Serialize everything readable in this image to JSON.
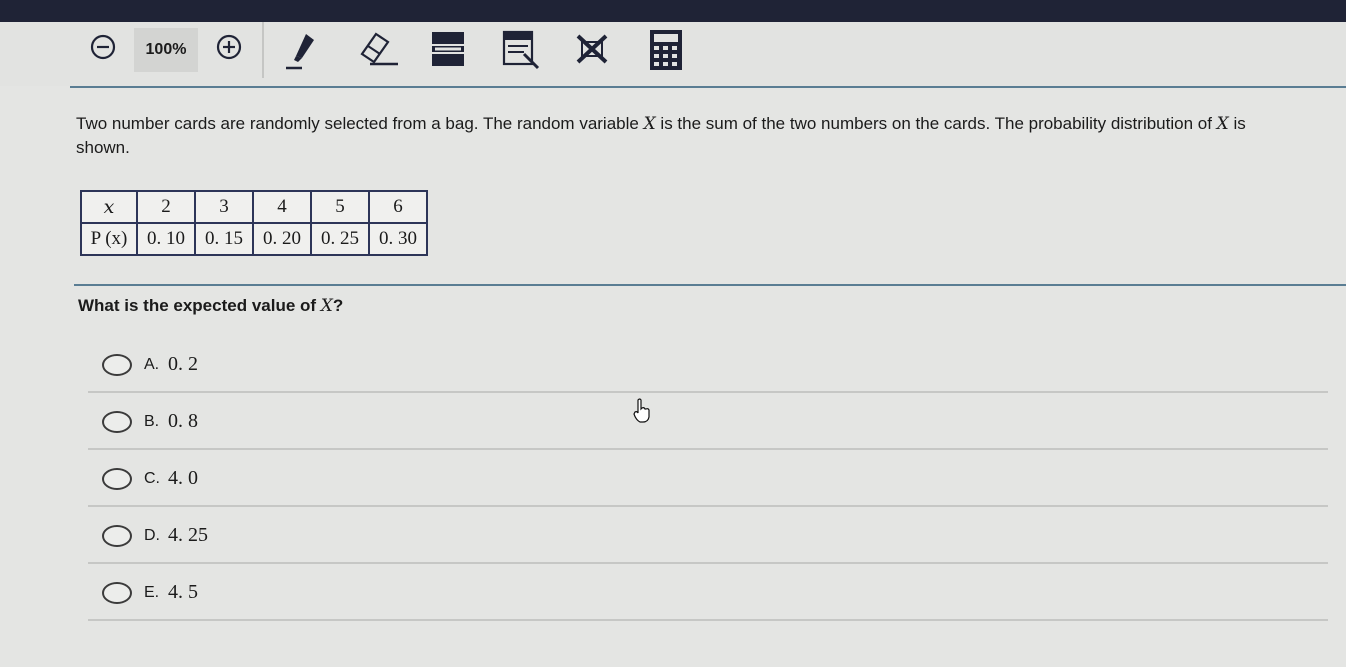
{
  "toolbar": {
    "zoom_level": "100%",
    "icons": [
      "zoom-out-icon",
      "zoom-in-icon",
      "highlighter-icon",
      "eraser-icon",
      "line-reader-icon",
      "answer-masking-icon",
      "option-eliminator-icon",
      "calculator-icon"
    ]
  },
  "question": {
    "stem_before_var1": "Two number cards are randomly selected from a bag. The random variable ",
    "var1": "X",
    "stem_between": " is the sum of the two numbers on the cards. The probability distribution of ",
    "var2": "X",
    "stem_after": " is shown.",
    "prompt_before": "What is the expected value of ",
    "prompt_var": "X",
    "prompt_after": "?"
  },
  "table": {
    "row1_header": "x",
    "row2_header": "P (x)",
    "x_values": [
      "2",
      "3",
      "4",
      "5",
      "6"
    ],
    "p_values": [
      "0. 10",
      "0. 15",
      "0. 20",
      "0. 25",
      "0. 30"
    ]
  },
  "choices": [
    {
      "letter": "A.",
      "value": "0. 2"
    },
    {
      "letter": "B.",
      "value": "0. 8"
    },
    {
      "letter": "C.",
      "value": "4. 0"
    },
    {
      "letter": "D.",
      "value": "4. 25"
    },
    {
      "letter": "E.",
      "value": "4. 5"
    }
  ]
}
